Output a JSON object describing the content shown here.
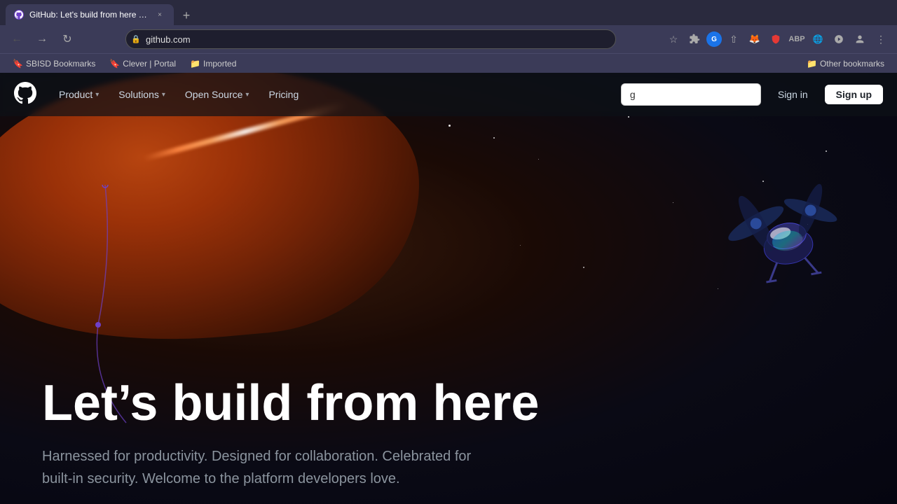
{
  "browser": {
    "tab": {
      "favicon": "🐙",
      "title": "GitHub: Let's build from here · G",
      "close_label": "×"
    },
    "new_tab_label": "+",
    "address": "github.com",
    "bookmarks": [
      {
        "id": "sbisd",
        "icon": "🔖",
        "label": "SBISD Bookmarks"
      },
      {
        "id": "clever",
        "icon": "🔖",
        "label": "Clever | Portal"
      },
      {
        "id": "imported",
        "icon": "📁",
        "label": "Imported"
      }
    ],
    "other_bookmarks_label": "Other bookmarks"
  },
  "nav": {
    "product_label": "Product",
    "solutions_label": "Solutions",
    "open_source_label": "Open Source",
    "pricing_label": "Pricing",
    "search_placeholder": "g",
    "search_value": "g",
    "signin_label": "Sign in",
    "signup_label": "Sign up"
  },
  "hero": {
    "title": "Let’s build from here",
    "subtitle": "Harnessed for productivity. Designed for collaboration. Celebrated for built-in security. Welcome to the platform developers love."
  }
}
